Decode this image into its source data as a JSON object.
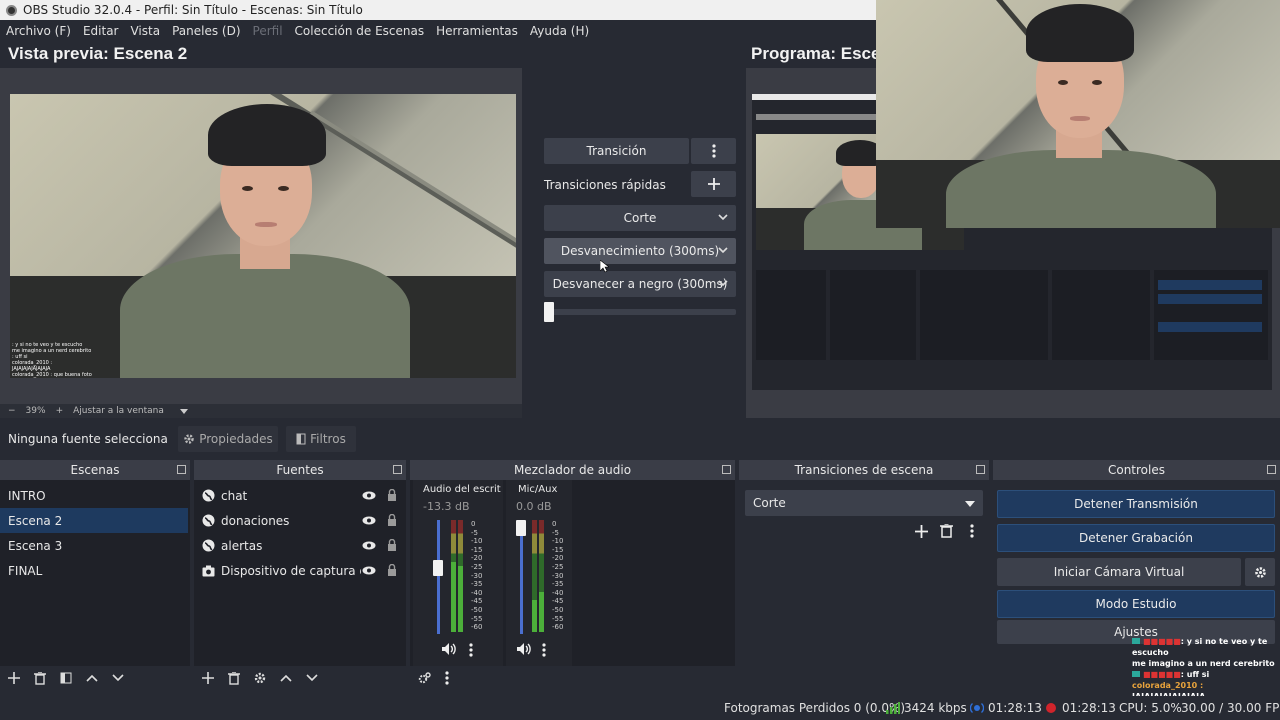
{
  "window": {
    "title": "OBS Studio 32.0.4 - Perfil: Sin Título - Escenas: Sin Título"
  },
  "menu": [
    "Archivo (F)",
    "Editar",
    "Vista",
    "Paneles (D)",
    "Perfil",
    "Colección de Escenas",
    "Herramientas",
    "Ayuda (H)"
  ],
  "preview": {
    "title": "Vista previa: Escena 2",
    "zoom": "39%",
    "zoom_minus": "−",
    "zoom_plus": "+",
    "fit_label": "Ajustar a la ventana"
  },
  "program": {
    "title": "Programa: Esce"
  },
  "transition_panel": {
    "transition_label": "Transición",
    "quick_label": "Transiciones rápidas",
    "items": [
      "Corte",
      "Desvanecimiento (300ms)",
      "Desvanecer a negro (300ms)"
    ],
    "tbar_level": 0
  },
  "source_bar": {
    "no_source": "Ninguna fuente selecciona",
    "properties": "Propiedades",
    "filters": "Filtros"
  },
  "scenes": {
    "title": "Escenas",
    "items": [
      "INTRO",
      "Escena 2",
      "Escena 3",
      "FINAL"
    ],
    "selected": "Escena 2"
  },
  "sources": {
    "title": "Fuentes",
    "items": [
      {
        "name": "chat",
        "icon": "globe-icon"
      },
      {
        "name": "donaciones",
        "icon": "globe-icon"
      },
      {
        "name": "alertas",
        "icon": "globe-icon"
      },
      {
        "name": "Dispositivo de captura de v",
        "icon": "camera-icon"
      }
    ]
  },
  "mixer": {
    "title": "Mezclador de audio",
    "channels": [
      {
        "name": "Audio del escritc",
        "db": "-13.3 dB",
        "level": 0.62
      },
      {
        "name": "Mic/Aux",
        "db": "0.0 dB",
        "level": 1.0
      }
    ],
    "scale": [
      "0",
      "-5",
      "-10",
      "-15",
      "-20",
      "-25",
      "-30",
      "-35",
      "-40",
      "-45",
      "-50",
      "-55",
      "-60"
    ]
  },
  "scene_transitions": {
    "title": "Transiciones de escena",
    "selected": "Corte"
  },
  "controls": {
    "title": "Controles",
    "stop_stream": "Detener Transmisión",
    "stop_record": "Detener Grabación",
    "virtual_cam": "Iniciar Cámara Virtual",
    "studio_mode": "Modo Estudio",
    "settings": "Ajustes"
  },
  "chat_overlay": [
    {
      "user": "",
      "text": ": y si no te veo y te escucho"
    },
    {
      "user": "",
      "text": "me imagino a un nerd cerebrito"
    },
    {
      "user": "",
      "text": ": uff si"
    },
    {
      "user": "",
      "text": "colorada_2010 :"
    },
    {
      "user": "",
      "text": "JAJAJAJAJAJAJAJA"
    },
    {
      "user": "",
      "text": "colorada_2010 : que buena foto"
    }
  ],
  "status": {
    "dropped": "Fotogramas Perdidos 0 (0.0%)",
    "bitrate": "3424 kbps",
    "stream_time": "01:28:13",
    "rec_time": "01:28:13",
    "cpu": "CPU: 5.0%",
    "fps": "30.00 / 30.00 FPS"
  },
  "colors": {
    "accent": "#1f3a5f",
    "live": "#2e6fd8",
    "rec": "#d0242b",
    "meter_green": "#4caf3a",
    "meter_yellow": "#c8b937",
    "meter_red": "#c9393a"
  }
}
